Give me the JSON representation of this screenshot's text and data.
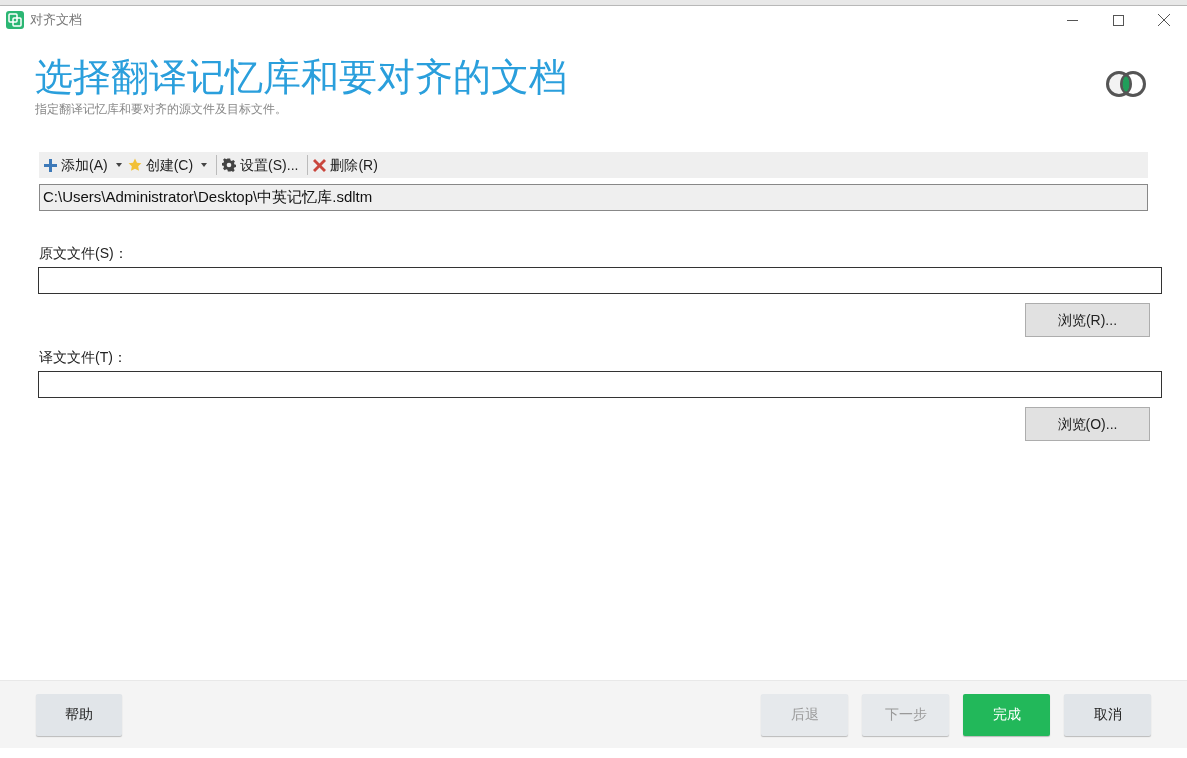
{
  "window": {
    "title": "对齐文档"
  },
  "header": {
    "title": "选择翻译记忆库和要对齐的文档",
    "subtitle": "指定翻译记忆库和要对齐的源文件及目标文件。"
  },
  "toolbar": [
    {
      "kind": "add",
      "label": "添加(A)",
      "dropdown": true
    },
    {
      "kind": "create",
      "label": "创建(C)",
      "dropdown": true
    },
    {
      "kind": "settings",
      "label": "设置(S)...",
      "dropdown": false
    },
    {
      "kind": "delete",
      "label": "删除(R)",
      "dropdown": false
    }
  ],
  "tm_list": [
    "C:\\Users\\Administrator\\Desktop\\中英记忆库.sdltm"
  ],
  "fields": [
    {
      "label": "原文文件(S)：",
      "browse": "浏览(R)..."
    },
    {
      "label": "译文文件(T)：",
      "browse": "浏览(O)..."
    }
  ],
  "footer": {
    "help": "帮助",
    "buttons": [
      {
        "label": "后退",
        "disabled": true,
        "primary": false
      },
      {
        "label": "下一步",
        "disabled": true,
        "primary": false
      },
      {
        "label": "完成",
        "disabled": false,
        "primary": true
      },
      {
        "label": "取消",
        "disabled": false,
        "primary": false
      }
    ]
  }
}
